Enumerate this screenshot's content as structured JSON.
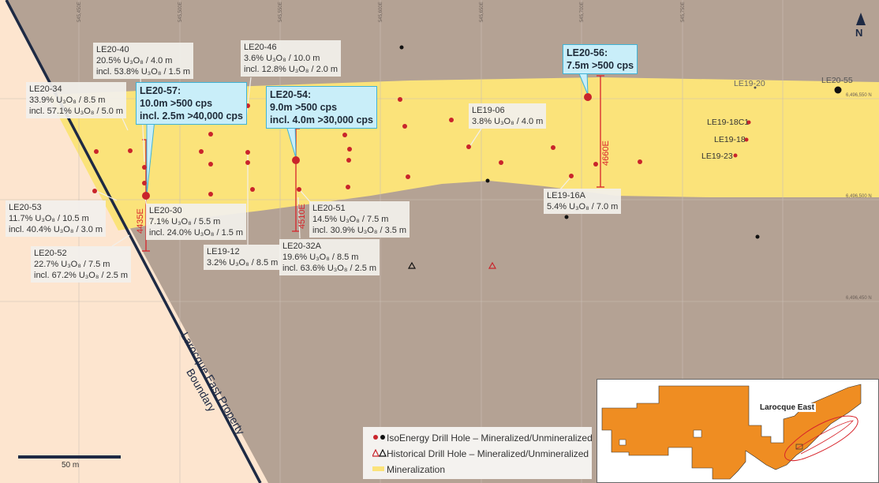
{
  "map": {
    "north_label": "N",
    "scale_label": "50 m",
    "boundary_label": [
      "Larocque East Property",
      "Boundary"
    ],
    "inset_label": "Larocque East",
    "grid_eastings": [
      "545,450E",
      "545,500E",
      "545,550E",
      "545,600E",
      "545,650E",
      "545,700E",
      "545,750E"
    ],
    "grid_northings": [
      "6,496,550 N",
      "6,496,500 N",
      "6,496,450 N"
    ],
    "section_lines": [
      "4435E",
      "4510E",
      "4660E"
    ],
    "colors": {
      "background": "#b4a294",
      "outside_property": "#fde5cf",
      "mineralization": "#fbe37a",
      "mineralized_hole": "#c9242b",
      "unmineralized_hole": "#111111",
      "boundary": "#1e2a44",
      "section_line": "#d8242b",
      "highlight_fill": "#c9eef9",
      "highlight_border": "#3fb3d6",
      "inset_property": "#ef8d22"
    }
  },
  "labels": {
    "le20_40": {
      "l1": "LE20-40",
      "l2": "20.5% U₃O₈ / 4.0 m",
      "l3": "incl. 53.8% U₃O₈ / 1.5 m"
    },
    "le20_46": {
      "l1": "LE20-46",
      "l2": "3.6% U₃O₈ / 10.0 m",
      "l3": "incl. 12.8% U₃O₈ / 2.0 m"
    },
    "le20_34": {
      "l1": "LE20-34",
      "l2": "33.9% U₃O₈ / 8.5 m",
      "l3": "incl. 57.1% U₃O₈ / 5.0 m"
    },
    "le19_06": {
      "l1": "LE19-06",
      "l2": "3.8% U₃O₈ / 4.0 m"
    },
    "le20_53": {
      "l1": "LE20-53",
      "l2": "11.7% U₃O₈ / 10.5 m",
      "l3": "incl. 40.4% U₃O₈ / 3.0 m"
    },
    "le20_30": {
      "l1": "LE20-30",
      "l2": "7.1% U₃O₈ / 5.5 m",
      "l3": "incl. 24.0% U₃O₈ / 1.5 m"
    },
    "le20_51": {
      "l1": "LE20-51",
      "l2": "14.5% U₃O₈ / 7.5 m",
      "l3": "incl. 30.9% U₃O₈ / 3.5 m"
    },
    "le19_16a": {
      "l1": "LE19-16A",
      "l2": "5.4% U₃O₈ / 7.0 m"
    },
    "le20_52": {
      "l1": "LE20-52",
      "l2": "22.7% U₃O₈ / 7.5 m",
      "l3": "incl. 67.2% U₃O₈ / 2.5 m"
    },
    "le19_12": {
      "l1": "LE19-12",
      "l2": "3.2% U₃O₈ / 8.5 m"
    },
    "le20_32a": {
      "l1": "LE20-32A",
      "l2": "19.6% U₃O₈ / 8.5 m",
      "l3": "incl. 63.6% U₃O₈ / 2.5 m"
    }
  },
  "highlights": {
    "le20_57": {
      "l1": "LE20-57:",
      "l2": "10.0m >500 cps",
      "l3": "incl. 2.5m >40,000 cps"
    },
    "le20_54": {
      "l1": "LE20-54:",
      "l2": "9.0m >500 cps",
      "l3": "incl. 4.0m >30,000 cps"
    },
    "le20_56": {
      "l1": "LE20-56:",
      "l2": "7.5m >500 cps"
    }
  },
  "plain_labels": {
    "le19_20": "LE19-20",
    "le20_55": "LE20-55",
    "le19_18c1": "LE19-18C1",
    "le19_18": "LE19-18",
    "le19_23": "LE19-23"
  },
  "legend": {
    "row1": "IsoEnergy Drill Hole – Mineralized/Unmineralized",
    "row2": "Historical Drill Hole – Mineralized/Unmineralized",
    "row3": "Mineralization"
  }
}
